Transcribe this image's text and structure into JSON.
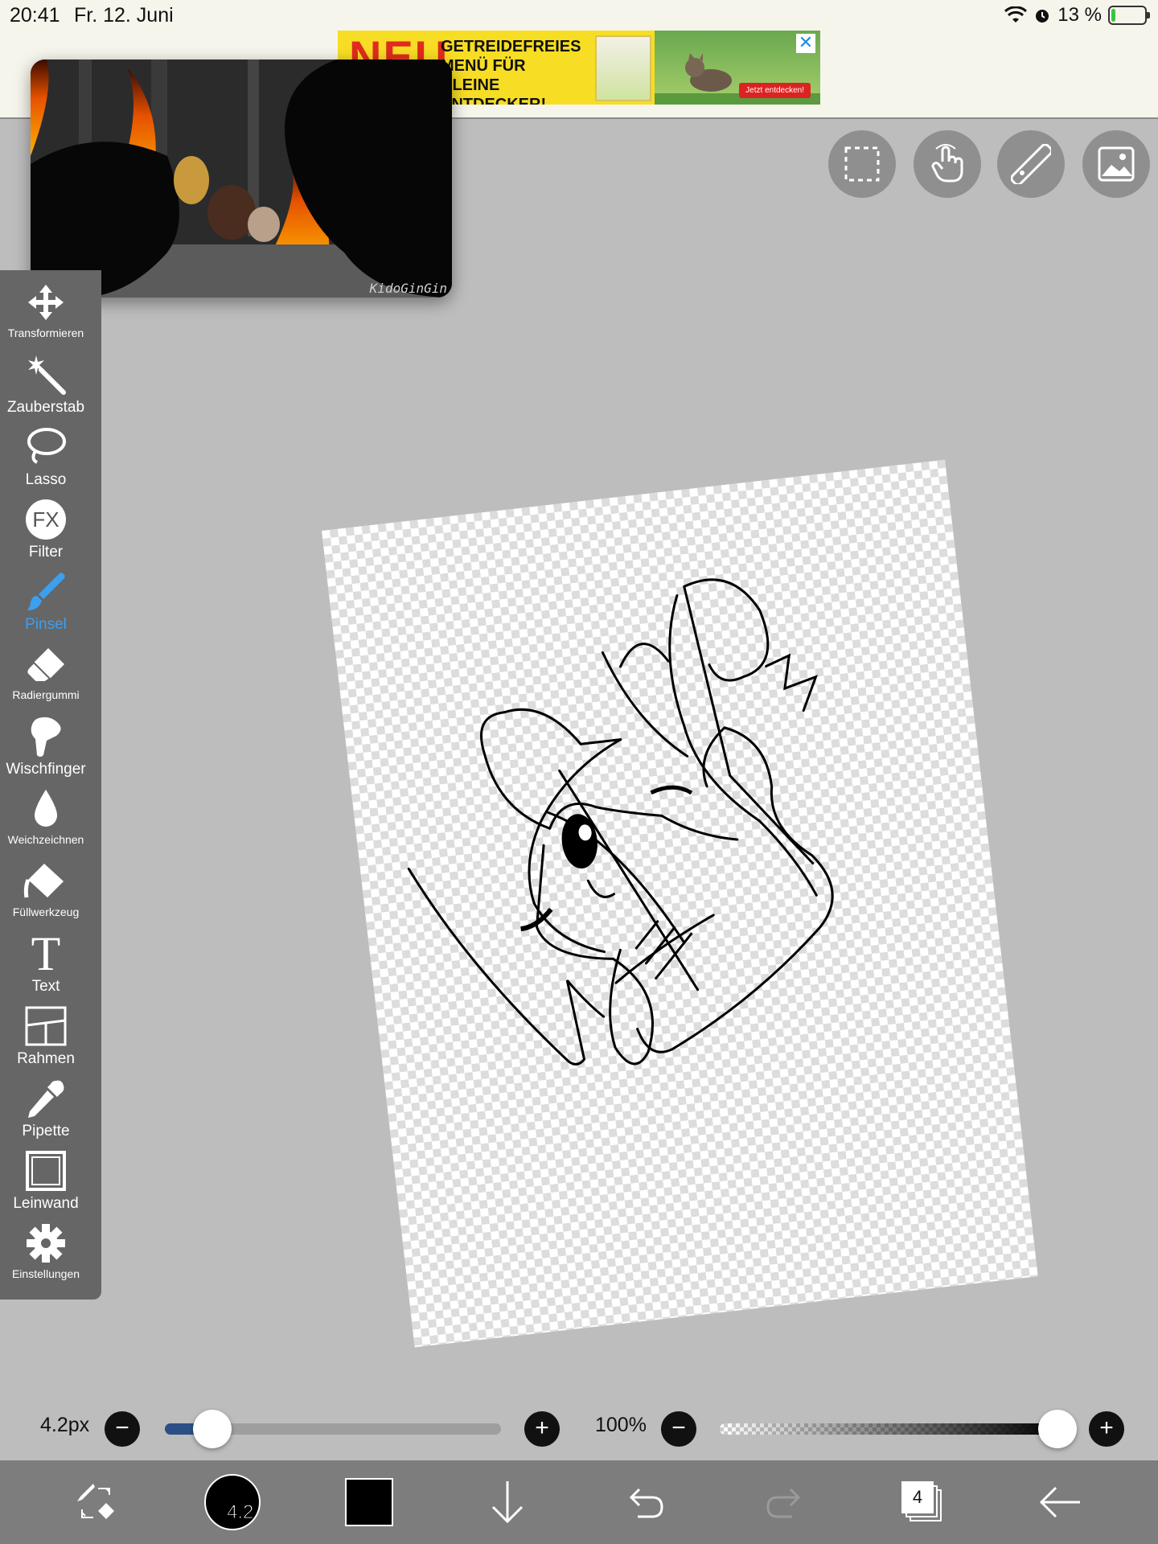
{
  "status_bar": {
    "time": "20:41",
    "date": "Fr. 12. Juni",
    "battery": "13 %",
    "battery_level": 0.13
  },
  "ad": {
    "headline": "NEU",
    "text": "GETREIDEFREIES MENÜ FÜR KLEINE ENTDECKER!",
    "cta": "Jetzt entdecken!",
    "close": "✕"
  },
  "video": {
    "watermark": "KidoGinGin"
  },
  "top_tools": [
    {
      "icon": "selection-icon"
    },
    {
      "icon": "touch-icon"
    },
    {
      "icon": "ruler-icon"
    },
    {
      "icon": "image-icon"
    }
  ],
  "toolbar": {
    "items": [
      {
        "label": "Transformieren",
        "icon": "move-icon"
      },
      {
        "label": "Zauberstab",
        "icon": "magic-wand-icon"
      },
      {
        "label": "Lasso",
        "icon": "lasso-icon"
      },
      {
        "label": "Filter",
        "icon": "fx-icon",
        "icon_text": "FX"
      },
      {
        "label": "Pinsel",
        "icon": "brush-icon",
        "active": true
      },
      {
        "label": "Radiergummi",
        "icon": "eraser-icon"
      },
      {
        "label": "Wischfinger",
        "icon": "smudge-icon"
      },
      {
        "label": "Weichzeichnen",
        "icon": "blur-drop-icon"
      },
      {
        "label": "Füllwerkzeug",
        "icon": "fill-bucket-icon"
      },
      {
        "label": "Text",
        "icon": "text-icon",
        "icon_text": "T"
      },
      {
        "label": "Rahmen",
        "icon": "frame-icon"
      },
      {
        "label": "Pipette",
        "icon": "eyedropper-icon"
      },
      {
        "label": "Leinwand",
        "icon": "canvas-icon"
      },
      {
        "label": "Einstellungen",
        "icon": "gear-icon"
      }
    ],
    "active_color": "#3b9ff2"
  },
  "brush_size": {
    "label": "4.2px",
    "minus": "−",
    "plus": "+",
    "level": 0.14
  },
  "opacity": {
    "label": "100%",
    "minus": "−",
    "plus": "+",
    "level": 1.0
  },
  "bottom_bar": {
    "brush_preview_value": "4.2",
    "color": "#000000",
    "layer_count": "4"
  }
}
